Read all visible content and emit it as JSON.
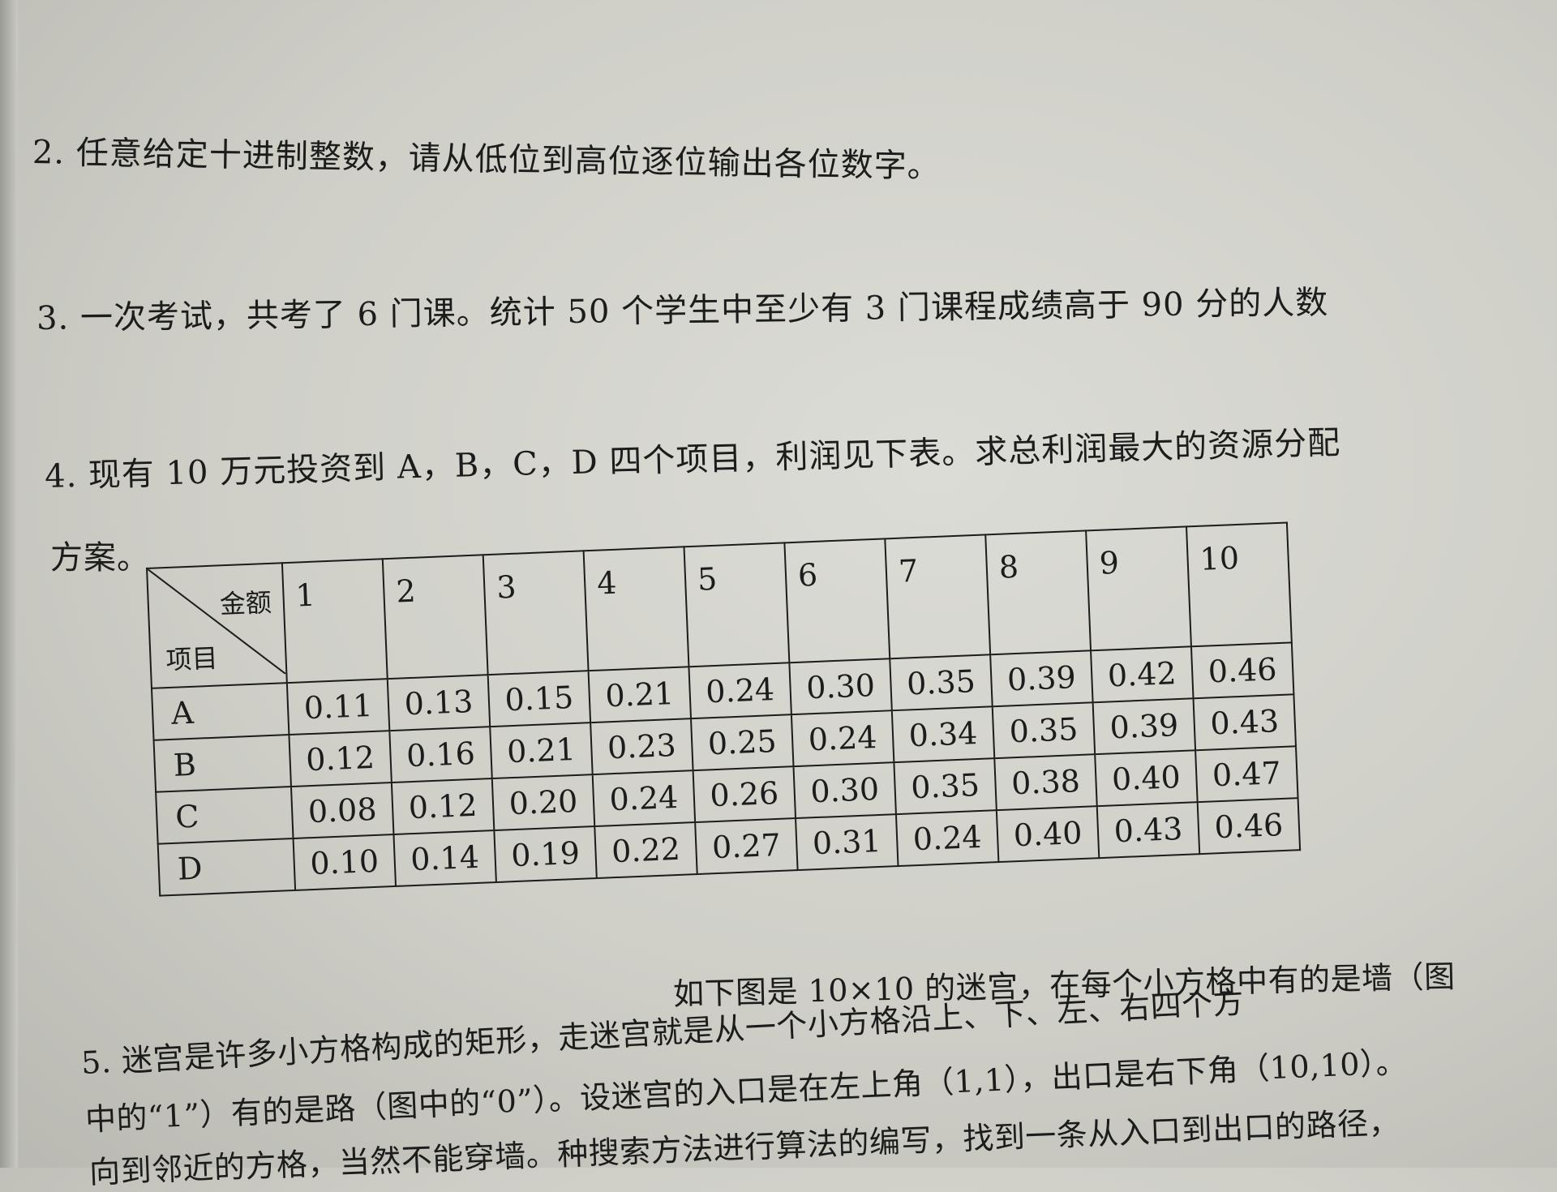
{
  "q2": "2. 任意给定十进制整数，请从低位到高位逐位输出各位数字。",
  "q3": "3. 一次考试，共考了 6 门课。统计 50 个学生中至少有 3 门课程成绩高于 90 分的人数",
  "q4_line1": "4. 现有 10 万元投资到 A，B，C，D 四个项目，利润见下表。求总利润最大的资源分配",
  "q4_line2": "方案。",
  "table": {
    "corner_top": "金额",
    "corner_bottom": "项目",
    "headers": [
      "1",
      "2",
      "3",
      "4",
      "5",
      "6",
      "7",
      "8",
      "9",
      "10"
    ],
    "rows": [
      {
        "label": "A",
        "values": [
          "0.11",
          "0.13",
          "0.15",
          "0.21",
          "0.24",
          "0.30",
          "0.35",
          "0.39",
          "0.42",
          "0.46"
        ]
      },
      {
        "label": "B",
        "values": [
          "0.12",
          "0.16",
          "0.21",
          "0.23",
          "0.25",
          "0.24",
          "0.34",
          "0.35",
          "0.39",
          "0.43"
        ]
      },
      {
        "label": "C",
        "values": [
          "0.08",
          "0.12",
          "0.20",
          "0.24",
          "0.26",
          "0.30",
          "0.35",
          "0.38",
          "0.40",
          "0.47"
        ]
      },
      {
        "label": "D",
        "values": [
          "0.10",
          "0.14",
          "0.19",
          "0.22",
          "0.27",
          "0.31",
          "0.24",
          "0.40",
          "0.43",
          "0.46"
        ]
      }
    ]
  },
  "q5_line1": "如下图是 10×10 的迷宫，在每个小方格中有的是墙（图",
  "q5_line2": "5. 迷宫是许多小方格构成的矩形，走迷宫就是从一个小方格沿上、下、左、右四个方",
  "q5_line3": "中的“1”）有的是路（图中的“0”）。设迷宫的入口是在左上角（1,1），出口是右下角（10,10）。",
  "q5_line4": "向到邻近的方格，当然不能穿墙。种搜索方法进行算法的编写，找到一条从入口到出口的路径，"
}
